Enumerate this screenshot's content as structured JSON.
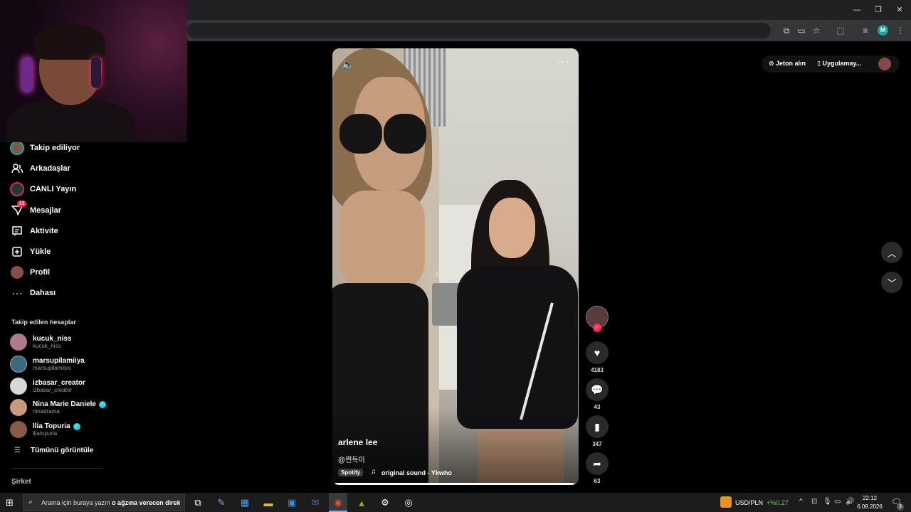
{
  "browser": {
    "window_controls": {
      "minimize": "—",
      "restore": "❐",
      "close": "✕"
    },
    "profile_initial": "M"
  },
  "sidebar": {
    "items": [
      {
        "label": "Takip ediliyor",
        "icon": "following-avatar-icon"
      },
      {
        "label": "Arkadaşlar",
        "icon": "friends-icon"
      },
      {
        "label": "CANLI Yayın",
        "icon": "live-icon"
      },
      {
        "label": "Mesajlar",
        "icon": "messages-icon",
        "badge": "11"
      },
      {
        "label": "Aktivite",
        "icon": "activity-icon"
      },
      {
        "label": "Yükle",
        "icon": "upload-icon"
      },
      {
        "label": "Profil",
        "icon": "profile-icon"
      },
      {
        "label": "Dahası",
        "icon": "more-icon"
      }
    ],
    "followed_heading": "Takip edilen hesaplar",
    "accounts": [
      {
        "name": "kucuk_niss",
        "username": "kucuk_niss",
        "verified": false,
        "color": "#b07a8a"
      },
      {
        "name": "marsupilamiiya",
        "username": "marsupilamiiya",
        "verified": false,
        "color": "#3a6a7a"
      },
      {
        "name": "izbasar_creator",
        "username": "izbasar_creator",
        "verified": false,
        "color": "#d8d8d8"
      },
      {
        "name": "Nina Marie Daniele",
        "username": "ninadrama",
        "verified": true,
        "color": "#c89a7a"
      },
      {
        "name": "Ilia Topuria",
        "username": "iliatopuria",
        "verified": true,
        "color": "#8a5a48"
      }
    ],
    "see_all": "Tümünü görüntüle",
    "company": "Şirket"
  },
  "video": {
    "author_name": "arlene lee",
    "caption": "@쩐득이",
    "spotify_tag": "Spotify",
    "sound": "original sound - Ykwho",
    "progress": 0.98
  },
  "actions": {
    "likes": "4183",
    "comments": "43",
    "saves": "347",
    "shares": "63"
  },
  "top_right": {
    "coins_label": "Jeton alın",
    "app_label": "Uygulamay..."
  },
  "taskbar": {
    "search_text": "Arama için buraya yazın",
    "overlay_text": "o ağzına verecen direk",
    "currency_pair": "USD/PLN",
    "currency_change": "+%0.27",
    "time": "22:12",
    "date": "6.08.2026",
    "notification_count": "9"
  },
  "colors": {
    "accent": "#fe2c55",
    "teal": "#20d5ec",
    "currency_up": "#6ac46a"
  }
}
